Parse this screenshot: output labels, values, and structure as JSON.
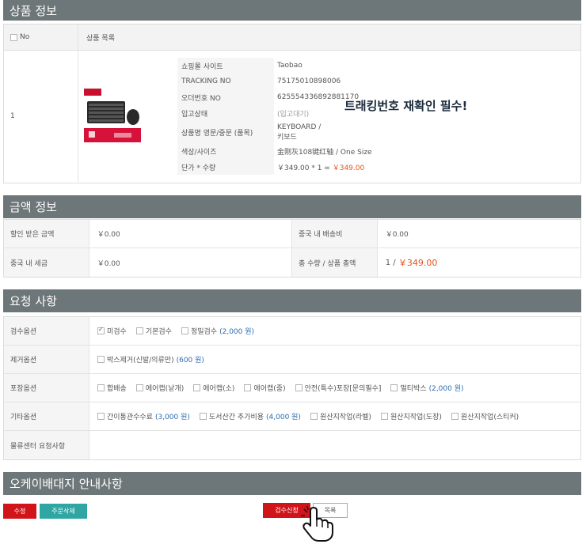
{
  "product_section": {
    "title": "상품 정보",
    "col_no": "No",
    "col_list": "상품 목록",
    "row_no": "1",
    "details": [
      {
        "label": "쇼핑몰 사이트",
        "value": "Taobao"
      },
      {
        "label": "TRACKING NO",
        "value": "75175010898006"
      },
      {
        "label": "오더번호 NO",
        "value": "625554336892881170"
      },
      {
        "label": "입고상태",
        "value": "(입고대기)"
      },
      {
        "label": "상품명 영문/중문 (품목)",
        "value_line1": "KEYBOARD /",
        "value_line2": "키보드"
      },
      {
        "label": "색상/사이즈",
        "value": "金刚灰108键红轴 / One Size"
      },
      {
        "label": "단가 * 수량",
        "value": "￥349.00 * 1 =",
        "total": "￥349.00"
      }
    ],
    "note": "트래킹번호 재확인 필수!"
  },
  "amount_section": {
    "title": "금액 정보",
    "rows": [
      {
        "l1": "할인 받은 금액",
        "v1": "￥0.00",
        "l2": "중국 내 배송비",
        "v2": "￥0.00"
      },
      {
        "l1": "중국 내 세금",
        "v1": "￥0.00",
        "l2": "총 수량 / 상품 총액",
        "v2_qty": "1 /",
        "v2_total": "￥349.00"
      }
    ]
  },
  "request_section": {
    "title": "요청 사항",
    "rows": [
      {
        "label": "검수옵션",
        "options": [
          {
            "text": "미검수",
            "checked": true,
            "price": ""
          },
          {
            "text": "기본검수",
            "checked": false,
            "price": ""
          },
          {
            "text": "정밀검수",
            "checked": false,
            "price": "(2,000 원)"
          }
        ]
      },
      {
        "label": "제거옵션",
        "options": [
          {
            "text": "박스제거(신발/의류만)",
            "checked": false,
            "price": "(600 원)"
          }
        ]
      },
      {
        "label": "포장옵션",
        "options": [
          {
            "text": "합배송",
            "checked": false,
            "price": ""
          },
          {
            "text": "에어캡(낱개)",
            "checked": false,
            "price": ""
          },
          {
            "text": "에어캡(소)",
            "checked": false,
            "price": ""
          },
          {
            "text": "에어캡(중)",
            "checked": false,
            "price": ""
          },
          {
            "text": "안전(특수)포장[문의필수]",
            "checked": false,
            "price": ""
          },
          {
            "text": "멀티박스",
            "checked": false,
            "price": "(2,000 원)"
          }
        ]
      },
      {
        "label": "기타옵션",
        "options": [
          {
            "text": "간이통관수수료",
            "checked": false,
            "price": "(3,000 원)"
          },
          {
            "text": "도서산간 추가비용",
            "checked": false,
            "price": "(4,000 원)"
          },
          {
            "text": "원산지작업(라벨)",
            "checked": false,
            "price": ""
          },
          {
            "text": "원산지작업(도장)",
            "checked": false,
            "price": ""
          },
          {
            "text": "원산지작업(스티커)",
            "checked": false,
            "price": ""
          }
        ]
      },
      {
        "label": "물류센터 요청사항",
        "options": []
      }
    ]
  },
  "guide_section": {
    "title": "오케이배대지 안내사항"
  },
  "buttons": {
    "edit": "수정",
    "delete_order": "주문삭제",
    "inspect_request": "검수신청",
    "list": "목록"
  },
  "colors": {
    "header_bg": "#6d7678",
    "accent_red": "#d0141a",
    "teal": "#2fa6a3",
    "link_blue": "#2b6cb0",
    "price_orange": "#e8501a"
  }
}
